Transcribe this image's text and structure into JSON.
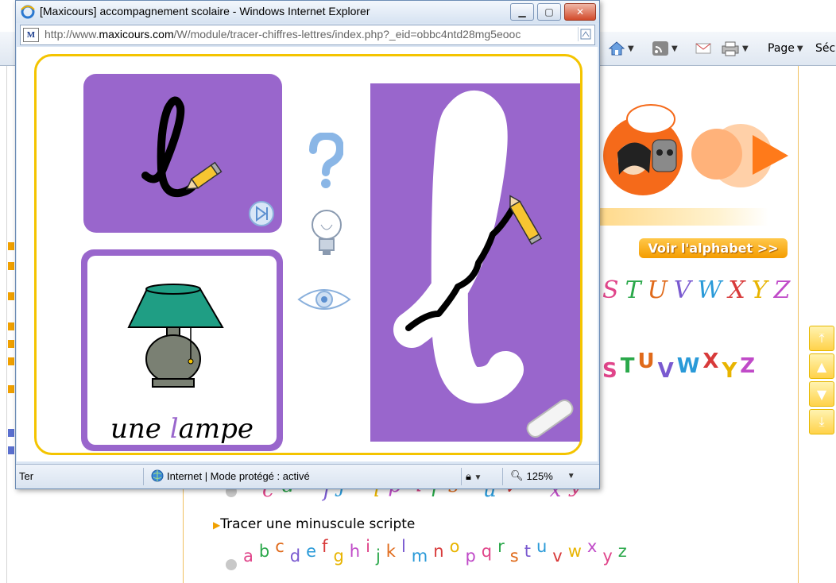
{
  "background_page": {
    "toolbar": {
      "page_label": "Page",
      "security_label": "Sécu"
    },
    "voir_alphabet": "Voir l'alphabet >>",
    "uppercase_cursive": [
      "S",
      "T",
      "U",
      "V",
      "W",
      "X",
      "Y",
      "Z"
    ],
    "uppercase_script": [
      "S",
      "T",
      "U",
      "V",
      "W",
      "X",
      "Y",
      "Z"
    ],
    "lowercase_cursive_row": [
      "c",
      "d",
      "e",
      "f",
      "j",
      "k",
      "l",
      "p",
      "q",
      "r",
      "s",
      "t",
      "u",
      "v",
      "w",
      "x",
      "y",
      "z"
    ],
    "section_label": "Tracer une minuscule scripte",
    "lowercase_script_row": [
      "a",
      "b",
      "c",
      "d",
      "e",
      "f",
      "g",
      "h",
      "i",
      "j",
      "k",
      "l",
      "m",
      "n",
      "o",
      "p",
      "q",
      "r",
      "s",
      "t",
      "u",
      "v",
      "w",
      "x",
      "y",
      "z"
    ],
    "letter_colors": [
      "#e0458a",
      "#2aa84a",
      "#e06a1a",
      "#7a5ad0",
      "#2a9ad8",
      "#d83a3a",
      "#e8b400",
      "#c04ac8"
    ]
  },
  "popup": {
    "title": "[Maxicours] accompagnement scolaire - Windows Internet Explorer",
    "url_prefix": "http://www.",
    "url_domain": "maxicours.com",
    "url_rest": "/W/module/tracer-chiffres-lettres/index.php?_eid=obbc4ntd28mg5eooc",
    "site_icon_letter": "M",
    "status_left": "Ter",
    "status_zone": "Internet | Mode protégé : activé",
    "zoom": "125%",
    "activity": {
      "model_letter": "l",
      "word_prefix": "une ",
      "word_highlight": "l",
      "word_suffix": "ampe",
      "highlight_color": "#9966cc",
      "card_color": "#9966cc",
      "frame_color": "#f4c400"
    }
  },
  "icons": [
    "ie-icon",
    "minimize-icon",
    "maximize-icon",
    "close-icon",
    "home-icon",
    "rss-icon",
    "mail-icon",
    "print-icon",
    "pencil-icon",
    "next-icon",
    "help-icon",
    "bulb-icon",
    "eye-icon",
    "eraser-icon",
    "lamp-image",
    "globe-icon",
    "zoom-icon",
    "speaker-icon",
    "tracer-logo"
  ]
}
